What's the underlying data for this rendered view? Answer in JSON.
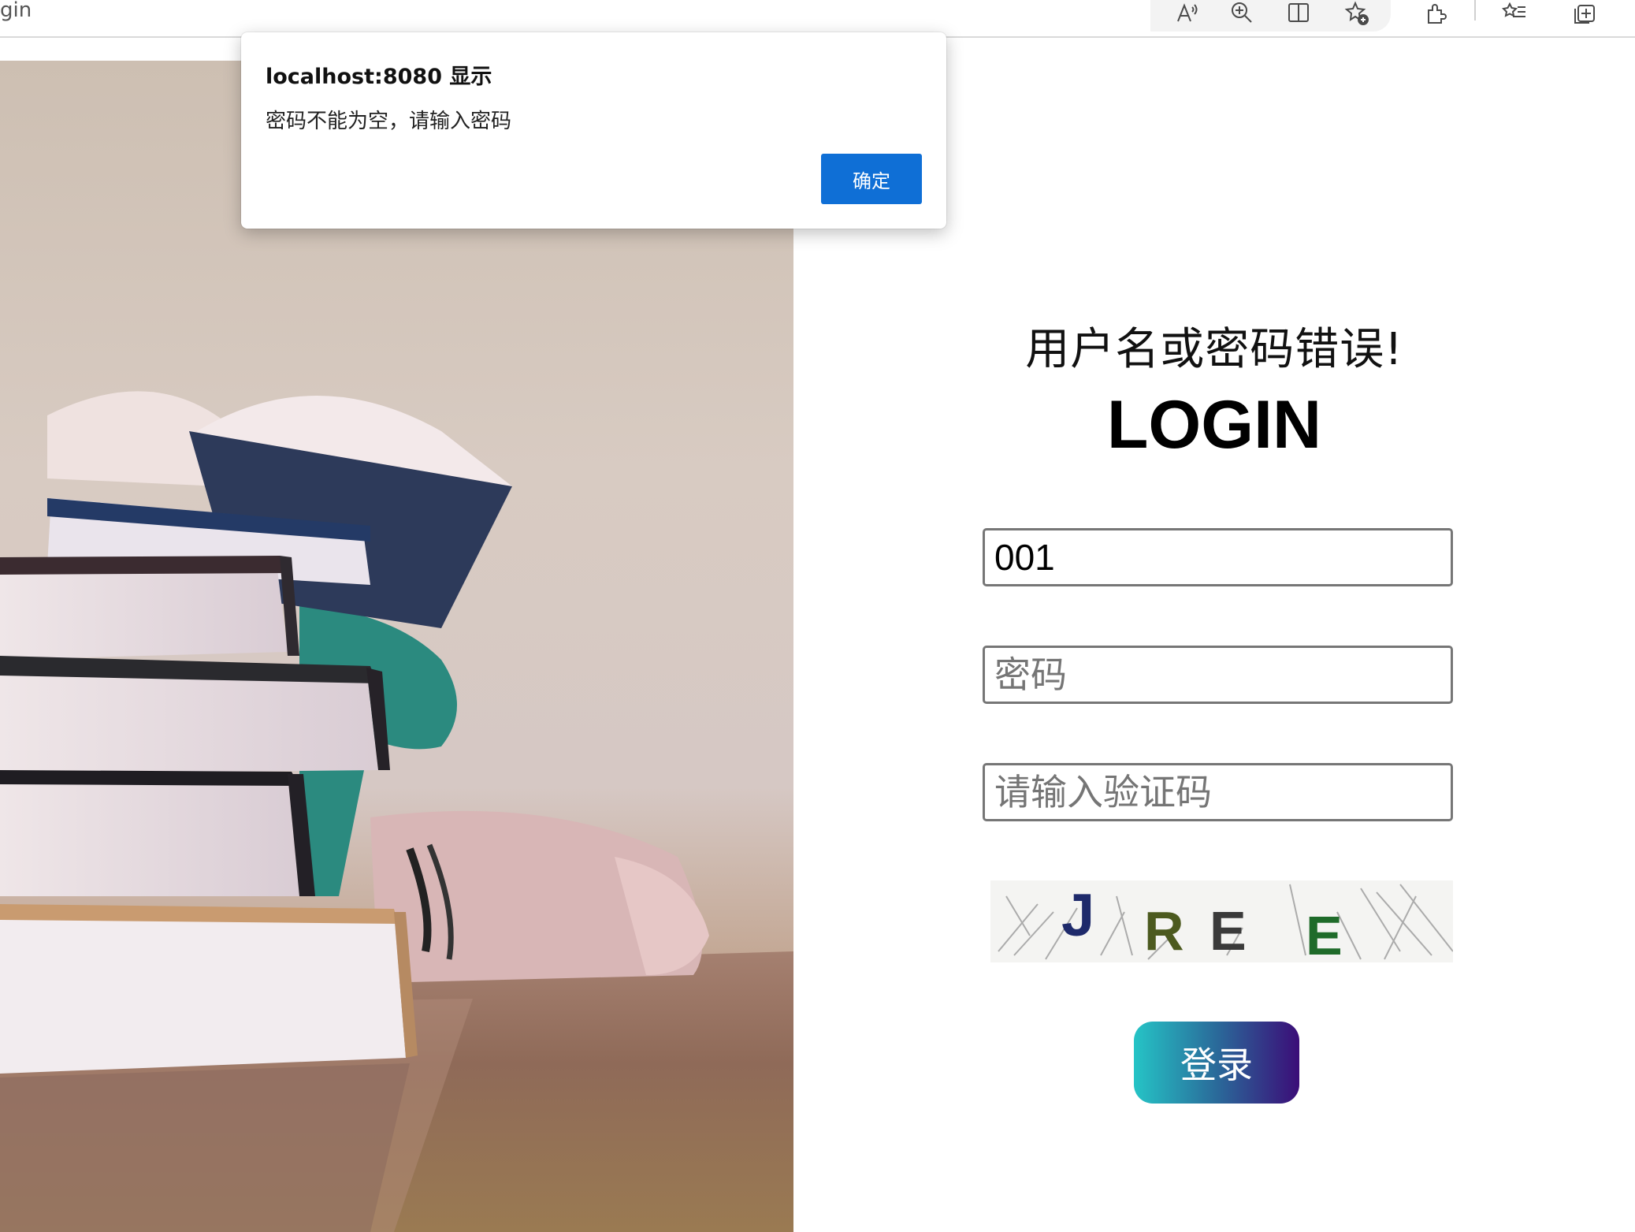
{
  "browser": {
    "tab_title_fragment": "gin",
    "toolbar_icons": [
      "read-aloud-icon",
      "zoom-icon",
      "split-screen-icon",
      "add-favorite-icon",
      "extensions-icon",
      "favorites-icon",
      "collections-icon"
    ]
  },
  "dialog": {
    "title": "localhost:8080 显示",
    "message": "密码不能为空，请输入密码",
    "ok_label": "确定",
    "ok_color": "#0f6fd6"
  },
  "login": {
    "error_message": "用户名或密码错误!",
    "title": "LOGIN",
    "username_value": "001",
    "password_placeholder": "密码",
    "captcha_placeholder": "请输入验证码",
    "captcha_text": "JREE",
    "submit_label": "登录",
    "button_gradient": [
      "#25c4c6",
      "#3b0d78"
    ]
  }
}
